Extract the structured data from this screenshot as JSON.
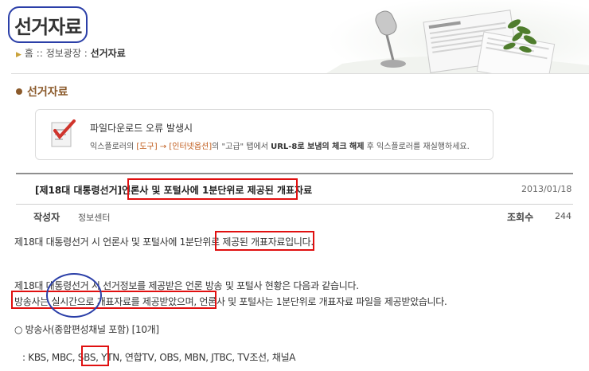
{
  "header": {
    "page_title": "선거자료",
    "breadcrumb": {
      "home": "홈",
      "sep1": "::",
      "section": "정보광장",
      "sep2": ":",
      "current": "선거자료"
    }
  },
  "section": {
    "title": "선거자료"
  },
  "notice": {
    "title": "파일다운로드 오류 발생시",
    "parts": {
      "p1": "익스플로러의 ",
      "tools": "[도구]",
      "arrow": " → ",
      "inet": "[인터넷옵션]",
      "p2": "의 \"고급\" 탭에서 ",
      "url": "URL-8로 보냄의 체크 해제",
      "p3": " 후 익스플로러를 재실행하세요."
    }
  },
  "post": {
    "title": "[제18대 대통령선거]언론사 및 포털사에 1분단위로 제공된 개표자료",
    "date": "2013/01/18",
    "author_label": "작성자",
    "author": "정보센터",
    "views_label": "조회수",
    "views": "244",
    "lines": {
      "l1": "제18대 대통령선거 시 언론사 및 포털사에 1분단위로 제공된 개표자료입니다.",
      "l2": "제18대 대통령선거 시 선거정보를 제공받은 언론 방송 및 포털사 현황은 다음과 같습니다.",
      "l3": "방송사는 실시간으로 개표자료를 제공받았으며, 언론사 및 포털사는 1분단위로 개표자료 파일을 제공받았습니다.",
      "l4": "○ 방송사(종합편성채널 포함) [10개]",
      "l5": ": KBS, MBC, SBS, YTN, 연합TV, OBS, MBN, JTBC, TV조선, 채널A"
    }
  }
}
